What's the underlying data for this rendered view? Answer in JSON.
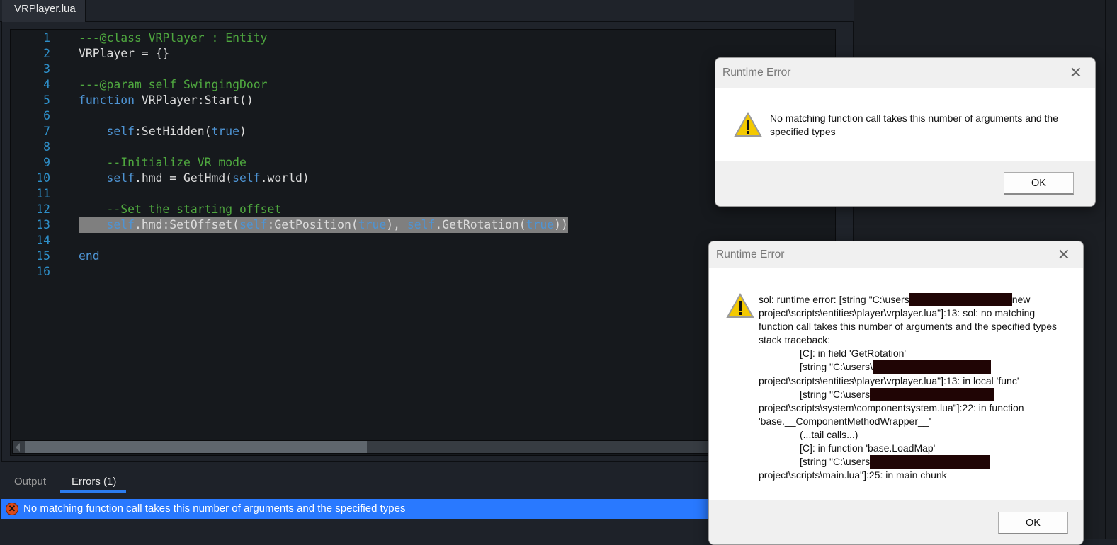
{
  "editor": {
    "tab_label": "VRPlayer.lua",
    "selected_line": 13,
    "lines": [
      [
        [
          "c",
          "---@class VRPlayer : Entity"
        ]
      ],
      [
        [
          "p",
          "VRPlayer = {}"
        ]
      ],
      [],
      [
        [
          "c",
          "---@param self SwingingDoor"
        ]
      ],
      [
        [
          "k",
          "function"
        ],
        [
          "p",
          " VRPlayer:Start()"
        ]
      ],
      [],
      [
        [
          "p",
          "    "
        ],
        [
          "k",
          "self"
        ],
        [
          "p",
          ":SetHidden("
        ],
        [
          "k",
          "true"
        ],
        [
          "p",
          ")"
        ]
      ],
      [],
      [
        [
          "p",
          "    "
        ],
        [
          "c",
          "--Initialize VR mode"
        ]
      ],
      [
        [
          "p",
          "    "
        ],
        [
          "k",
          "self"
        ],
        [
          "p",
          ".hmd = GetHmd("
        ],
        [
          "k",
          "self"
        ],
        [
          "p",
          ".world)"
        ]
      ],
      [],
      [
        [
          "p",
          "    "
        ],
        [
          "c",
          "--Set the starting offset"
        ]
      ],
      [
        [
          "p",
          "    "
        ],
        [
          "k",
          "self"
        ],
        [
          "p",
          ".hmd:SetOffset("
        ],
        [
          "k",
          "self"
        ],
        [
          "p",
          ":GetPosition("
        ],
        [
          "k",
          "true"
        ],
        [
          "p",
          "), "
        ],
        [
          "k",
          "self"
        ],
        [
          "p",
          ".GetRotation("
        ],
        [
          "k",
          "true"
        ],
        [
          "p",
          "))"
        ]
      ],
      [],
      [
        [
          "k",
          "end"
        ]
      ],
      []
    ]
  },
  "bottom_panel": {
    "tabs": [
      {
        "label": "Output"
      },
      {
        "label": "Errors (1)"
      }
    ],
    "active_tab": "Errors (1)",
    "error_message": "No matching function call takes this number of arguments and the specified types"
  },
  "dialog1": {
    "title": "Runtime Error",
    "message_line1": "No matching function call takes this number of arguments and the",
    "message_line2": "specified types",
    "ok_label": "OK"
  },
  "dialog2": {
    "title": "Runtime Error",
    "l1a": "sol: runtime error: [string \"C:\\users",
    "l1b": "new",
    "l2": "project\\scripts\\entities\\player\\vrplayer.lua\"]:13: sol: no matching",
    "l3": "function call takes this number of arguments and the specified types",
    "l4": "stack traceback:",
    "l5": "[C]: in field 'GetRotation'",
    "l6": "[string \"C:\\users\\",
    "l7": "project\\scripts\\entities\\player\\vrplayer.lua\"]:13: in local 'func'",
    "l8": "[string \"C:\\users",
    "l9": "project\\scripts\\system\\componentsystem.lua\"]:22: in function",
    "l10": "'base.__ComponentMethodWrapper__'",
    "l11": "(...tail calls...)",
    "l12": "[C]: in function 'base.LoadMap'",
    "l13": "[string \"C:\\users",
    "l14": "project\\scripts\\main.lua\"]:25: in main chunk",
    "ok_label": "OK"
  }
}
